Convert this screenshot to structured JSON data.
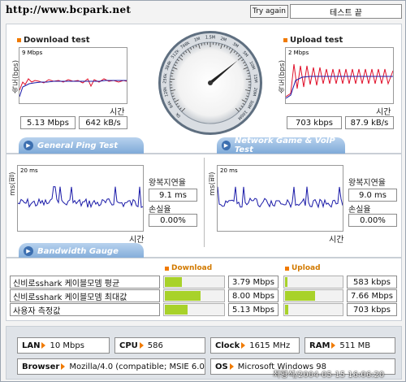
{
  "header": {
    "url": "http://www.bcpark.net",
    "try_again_label": "Try again",
    "status": "테스트 끝"
  },
  "download": {
    "title": "Download test",
    "ylabel": "속도(bps)",
    "scale": "9 Mbps",
    "xlabel": "시간",
    "mbps": "5.13 Mbps",
    "kbs": "642 kB/s"
  },
  "upload": {
    "title": "Upload test",
    "ylabel": "속도(bps)",
    "scale": "2 Mbps",
    "xlabel": "시간",
    "kbps": "703 kbps",
    "kbs": "87.9 kB/s"
  },
  "gauge": {
    "ticks": [
      "0k",
      "64k",
      "128k",
      "256k",
      "384k",
      "512k",
      "768k",
      "1M",
      "1.5M",
      "2M",
      "3M",
      "5M",
      "10M",
      "15M",
      "20M",
      "50M",
      "100M"
    ],
    "needle_value": "5M"
  },
  "ping": {
    "tab_label": "General Ping Test",
    "ylabel": "ms(핑)",
    "scale": "20 ms",
    "xlabel": "시간",
    "rtt_label": "왕복지연율",
    "rtt": "9.1 ms",
    "loss_label": "손실율",
    "loss": "0.00%"
  },
  "game": {
    "tab_label": "Network Game & VoIP Test",
    "ylabel": "ms(핑)",
    "scale": "20 ms",
    "xlabel": "시간",
    "rtt_label": "왕복지연율",
    "rtt": "9.0 ms",
    "loss_label": "손실율",
    "loss": "0.00%"
  },
  "bandwidth": {
    "tab_label": "Bandwidth Gauge",
    "download_label": "Download",
    "upload_label": "Upload",
    "rows": [
      {
        "label": "신비로sshark 케이블모뎀 평균",
        "down": "3.79 Mbps",
        "down_fill": 0.28,
        "up": "583 kbps",
        "up_fill": 0.04
      },
      {
        "label": "신비로sshark 케이블모뎀 최대값",
        "down": "8.00 Mbps",
        "down_fill": 0.6,
        "up": "7.66 Mbps",
        "up_fill": 0.52
      },
      {
        "label": "사용자 측정값",
        "down": "5.13 Mbps",
        "down_fill": 0.38,
        "up": "703 kbps",
        "up_fill": 0.05
      }
    ]
  },
  "system": {
    "lan_key": "LAN",
    "lan": "10 Mbps",
    "cpu_key": "CPU",
    "cpu": "586",
    "clock_key": "Clock",
    "clock": "1615 MHz",
    "ram_key": "RAM",
    "ram": "511 MB",
    "browser_key": "Browser",
    "browser": "Mozilla/4.0 (compatible; MSIE 6.0",
    "os_key": "OS",
    "os": "Microsoft Windows 98"
  },
  "watermark": "최형석/2004-05-15 16:06:20",
  "colors": {
    "accent": "#f07a00",
    "bar_fill": "#a8d22a",
    "series_red": "#e0102a",
    "series_blue": "#1a1aa8",
    "tab_blue": "#7faad8"
  }
}
